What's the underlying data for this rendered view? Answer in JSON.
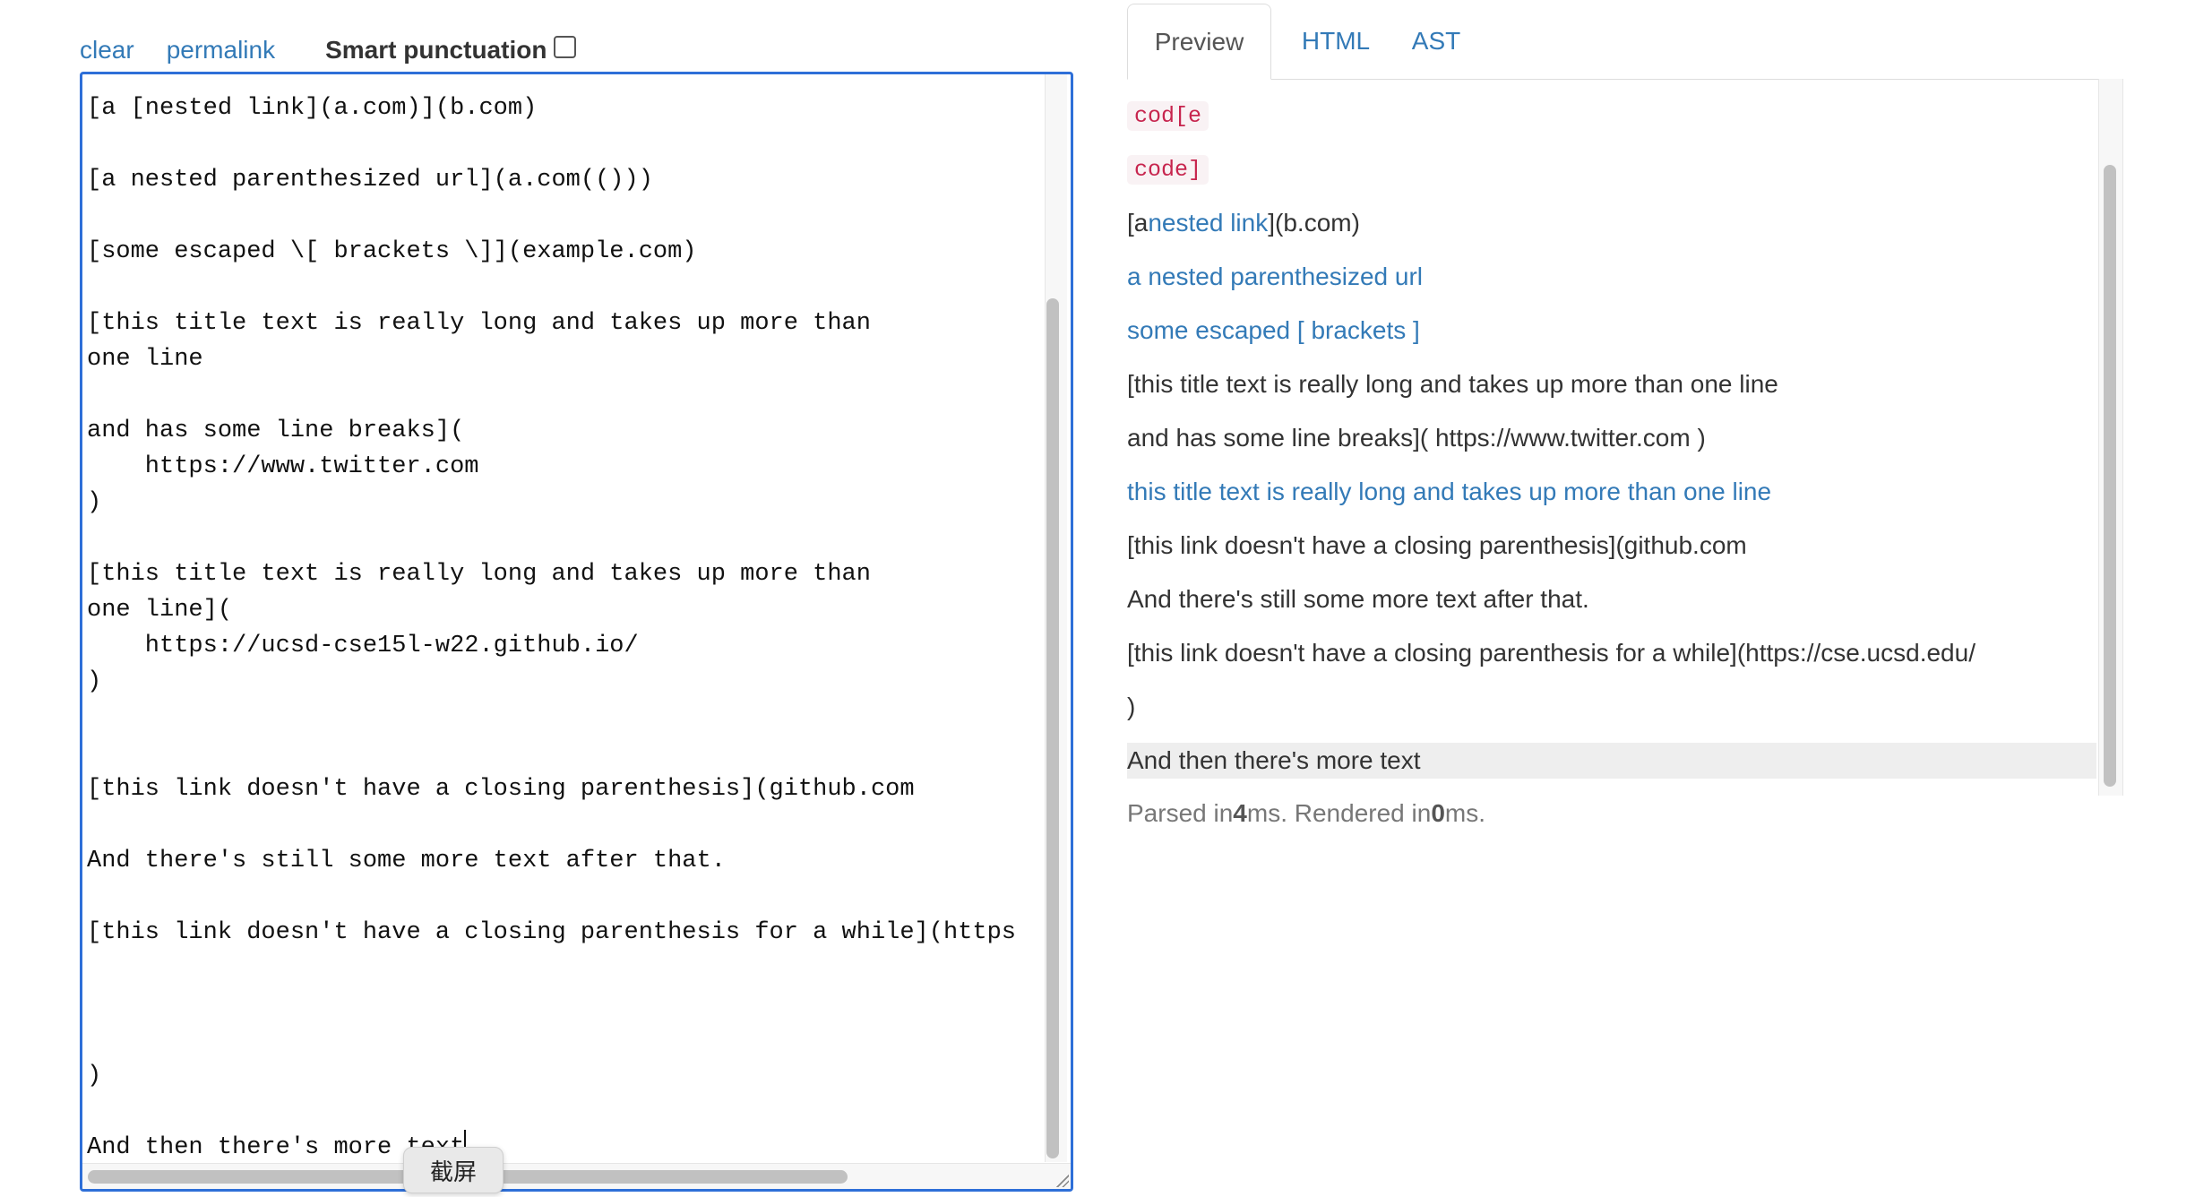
{
  "toolbar": {
    "clear_label": "clear",
    "permalink_label": "permalink",
    "smart_punctuation_label": "Smart punctuation",
    "smart_punctuation_checked": false
  },
  "editor": {
    "lines": [
      "[a [nested link](a.com)](b.com)",
      "",
      "[a nested parenthesized url](a.com(()))",
      "",
      "[some escaped \\[ brackets \\]](example.com)",
      "",
      "[this title text is really long and takes up more than",
      "one line",
      "",
      "and has some line breaks](",
      "    https://www.twitter.com",
      ")",
      "",
      "[this title text is really long and takes up more than",
      "one line](",
      "    https://ucsd-cse15l-w22.github.io/",
      ")",
      "",
      "",
      "[this link doesn't have a closing parenthesis](github.com",
      "",
      "And there's still some more text after that.",
      "",
      "[this link doesn't have a closing parenthesis for a while](https",
      "",
      "",
      "",
      ")",
      "",
      "And then there's more text"
    ]
  },
  "overlay": {
    "screenshot_tip": "截屏"
  },
  "tabs": [
    {
      "label": "Preview",
      "active": true
    },
    {
      "label": "HTML",
      "active": false
    },
    {
      "label": "AST",
      "active": false
    }
  ],
  "preview": {
    "code1": "cod[e",
    "code2": "code]",
    "line3": {
      "before": "[a ",
      "link": "nested link",
      "after": "](b.com)"
    },
    "line4_link": "a nested parenthesized url",
    "line5_link": "some escaped [ brackets ]",
    "line6": "[this title text is really long and takes up more than one line",
    "line7": "and has some line breaks]( https://www.twitter.com )",
    "line8_link": "this title text is really long and takes up more than one line",
    "line9": "[this link doesn't have a closing parenthesis](github.com",
    "line10": "And there's still some more text after that.",
    "line11": "[this link doesn't have a closing parenthesis for a while](https://cse.ucsd.edu/",
    "line12": ")",
    "line13": "And then there's more text"
  },
  "timing": {
    "parsed_prefix": "Parsed in ",
    "parsed_ms": "4",
    "rendered_prefix": " ms. Rendered in ",
    "rendered_ms": "0",
    "suffix": " ms."
  },
  "colors": {
    "link": "#337ab7",
    "editor_border": "#2e6fd8",
    "code_text": "#c7254e",
    "code_bg": "#f9f2f4",
    "highlight_bg": "#eeeeee"
  }
}
